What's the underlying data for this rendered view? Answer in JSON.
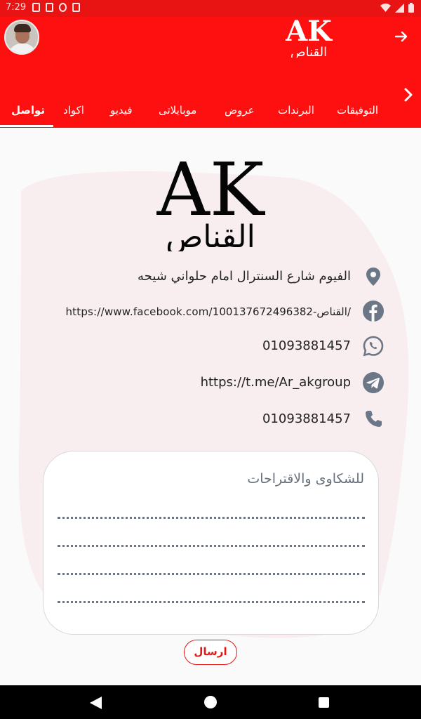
{
  "status_bar": {
    "time": "7:29"
  },
  "tabs": [
    {
      "label": "التوفيقات",
      "active": false
    },
    {
      "label": "البرندات",
      "active": false
    },
    {
      "label": "عروض",
      "active": false
    },
    {
      "label": "موبايلاتى",
      "active": false
    },
    {
      "label": "فيديو",
      "active": false
    },
    {
      "label": "اكواد",
      "active": false
    },
    {
      "label": "تواصل",
      "active": true
    }
  ],
  "logo": {
    "latin": "AK",
    "arabic": "القناص"
  },
  "contacts": [
    {
      "icon": "location-pin-icon",
      "text": "الفيوم شارع السنترال امام حلواني شيحه"
    },
    {
      "icon": "facebook-icon",
      "text": "https://www.facebook.com/القناص-100137672496382/"
    },
    {
      "icon": "whatsapp-icon",
      "text": "01093881457"
    },
    {
      "icon": "telegram-icon",
      "text": "https://t.me/Ar_akgroup"
    },
    {
      "icon": "phone-icon",
      "text": "01093881457"
    }
  ],
  "feedback": {
    "title": "للشكاوى والاقتراحات"
  },
  "send_button": {
    "label": "ارسال"
  },
  "colors": {
    "brand": "#ff1010",
    "icon_gray": "#6b7686"
  }
}
